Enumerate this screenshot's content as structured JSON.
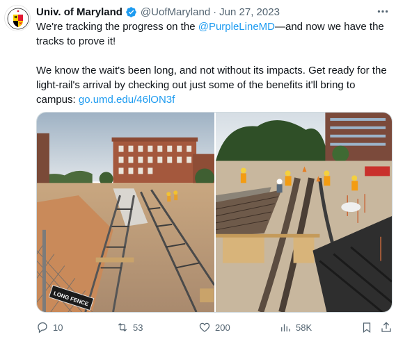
{
  "tweet": {
    "display_name": "Univ. of Maryland",
    "handle": "@UofMaryland",
    "separator": "·",
    "date": "Jun 27, 2023",
    "line1_before": "We're tracking the progress on the ",
    "mention": "@PurpleLineMD",
    "line1_after": "—and now we have the tracks to prove it!",
    "line2": "We know the wait's been long, and not without its impacts. Get ready for the light-rail's arrival by checking out just some of the benefits it'll bring to campus: ",
    "link": "go.umd.edu/46lON3f",
    "fence_sign": "LONG FENCE"
  },
  "actions": {
    "replies": "10",
    "reposts": "53",
    "likes": "200",
    "views": "58K"
  },
  "icons": [
    "verified-icon",
    "more-icon",
    "reply-icon",
    "repost-icon",
    "like-icon",
    "views-icon",
    "bookmark-icon",
    "share-icon"
  ],
  "colors": {
    "accent": "#1d9bf0",
    "text": "#0f1419",
    "muted": "#536471",
    "verified": "#1d9bf0"
  }
}
